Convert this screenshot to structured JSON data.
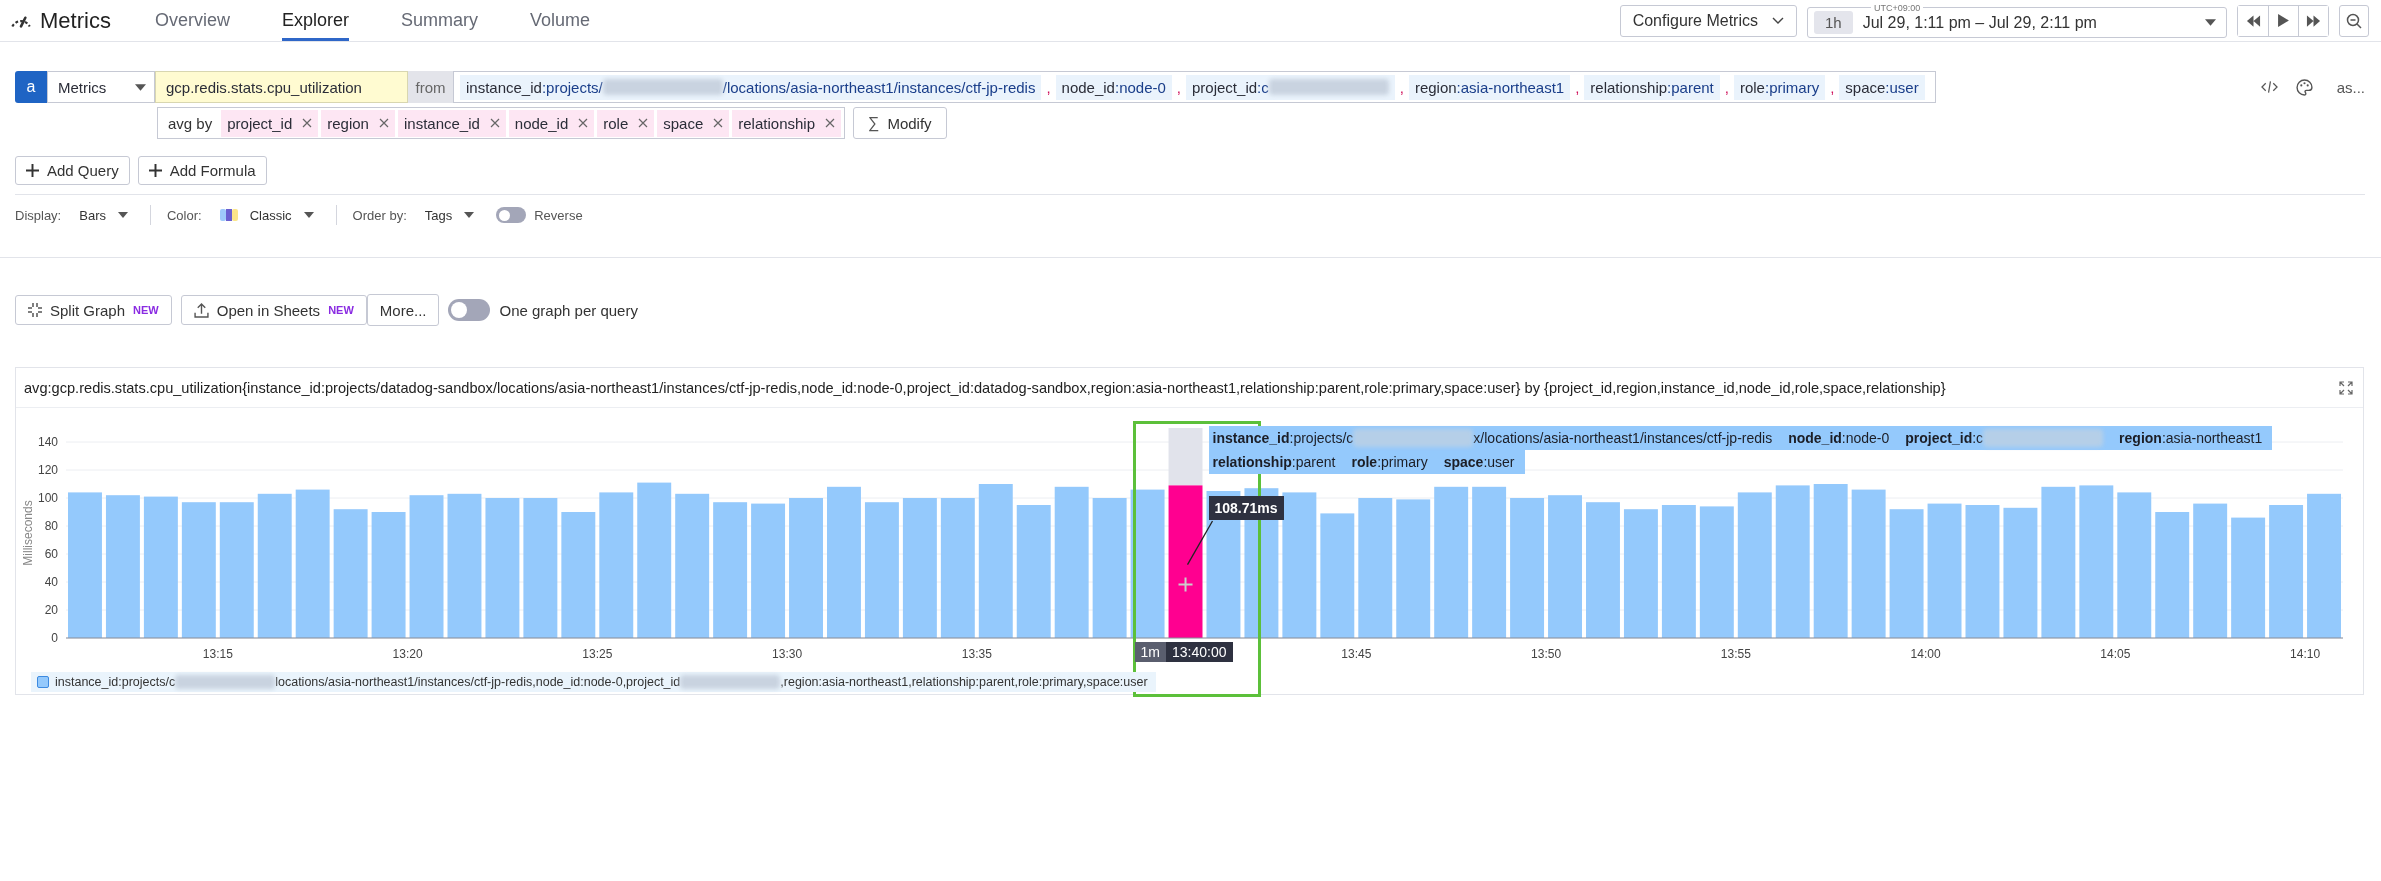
{
  "header": {
    "title": "Metrics",
    "tabs": [
      {
        "label": "Overview",
        "selected": false
      },
      {
        "label": "Explorer",
        "selected": true
      },
      {
        "label": "Summary",
        "selected": false
      },
      {
        "label": "Volume",
        "selected": false
      }
    ],
    "configure_button": "Configure Metrics",
    "time_picker": {
      "timezone": "UTC+09:00",
      "span": "1h",
      "range": "Jul 29, 1:11 pm – Jul 29, 2:11 pm"
    }
  },
  "query": {
    "letter": "a",
    "source": "Metrics",
    "metric": "gcp.redis.stats.cpu_utilization",
    "from_label": "from",
    "separator": ",",
    "from_tags": [
      {
        "key": "instance_id",
        "parts": [
          {
            "text": ":projects/"
          },
          {
            "redacted": true
          },
          {
            "text": "/locations/asia-northeast1/instances/ctf-jp-redis"
          }
        ]
      },
      {
        "key": "node_id",
        "parts": [
          {
            "text": ":node-0"
          }
        ]
      },
      {
        "key": "project_id",
        "parts": [
          {
            "text": ":c"
          },
          {
            "redacted": true
          }
        ]
      },
      {
        "key": "region",
        "parts": [
          {
            "text": ":asia-northeast1"
          }
        ]
      },
      {
        "key": "relationship",
        "parts": [
          {
            "text": ":parent"
          }
        ]
      },
      {
        "key": "role",
        "parts": [
          {
            "text": ":primary"
          }
        ]
      },
      {
        "key": "space",
        "parts": [
          {
            "text": ":user"
          }
        ]
      }
    ],
    "avg_by_label": "avg by",
    "group_by": [
      "project_id",
      "region",
      "instance_id",
      "node_id",
      "role",
      "space",
      "relationship"
    ],
    "modify_button": {
      "icon": "∑",
      "label": "Modify"
    },
    "side_label": "as..."
  },
  "add_buttons": [
    "Add Query",
    "Add Formula"
  ],
  "display_options": [
    {
      "kind": "select",
      "label": "Display:",
      "value": "Bars"
    },
    {
      "kind": "palette",
      "label": "Color:",
      "value": "Classic"
    },
    {
      "kind": "select",
      "label": "Order by:",
      "value": "Tags"
    },
    {
      "kind": "toggle",
      "label": "Reverse",
      "on": false
    }
  ],
  "graph_actions": [
    {
      "kind": "split",
      "label": "Split Graph",
      "badge": "NEW"
    },
    {
      "kind": "export",
      "label": "Open in Sheets",
      "badge": "NEW"
    },
    {
      "kind": "more",
      "label": "More..."
    }
  ],
  "one_graph_toggle": {
    "label": "One graph per query",
    "on": false
  },
  "graph": {
    "title": "avg:gcp.redis.stats.cpu_utilization{instance_id:projects/datadog-sandbox/locations/asia-northeast1/instances/ctf-jp-redis,node_id:node-0,project_id:datadog-sandbox,region:asia-northeast1,relationship:parent,role:primary,space:user} by {project_id,region,instance_id,node_id,role,space,relationship}",
    "chart_data": {
      "type": "bar",
      "ylabel": "Milliseconds",
      "ylim": [
        0,
        150
      ],
      "grid": true,
      "stacked": true,
      "categories": [
        null,
        null,
        null,
        null,
        "13:15",
        null,
        null,
        null,
        null,
        "13:20",
        null,
        null,
        null,
        null,
        "13:25",
        null,
        null,
        null,
        null,
        "13:30",
        null,
        null,
        null,
        null,
        "13:35",
        null,
        null,
        null,
        null,
        null,
        null,
        null,
        null,
        null,
        "13:45",
        null,
        null,
        null,
        null,
        "13:50",
        null,
        null,
        null,
        null,
        "13:55",
        null,
        null,
        null,
        null,
        "14:00",
        null,
        null,
        null,
        null,
        "14:05",
        null,
        null,
        null,
        null,
        "14:10"
      ],
      "yticks": [
        0,
        20,
        40,
        60,
        80,
        100,
        120,
        140
      ],
      "series": [
        {
          "color": "#94c9fc",
          "values": [
            104,
            102,
            101,
            97,
            97,
            103,
            106,
            92,
            90,
            102,
            103,
            100,
            100,
            90,
            104,
            111,
            103,
            97,
            96,
            100,
            108,
            97,
            100,
            100,
            110,
            95,
            108,
            100,
            106,
            null,
            105,
            107,
            104,
            89,
            100,
            99,
            108,
            108,
            100,
            102,
            97,
            92,
            95,
            94,
            104,
            109,
            110,
            106,
            92,
            96,
            95,
            93,
            108,
            109,
            104,
            90,
            96,
            86,
            95,
            103
          ]
        },
        {
          "color": "#ff0090",
          "values": [
            null,
            null,
            null,
            null,
            null,
            null,
            null,
            null,
            null,
            null,
            null,
            null,
            null,
            null,
            null,
            null,
            null,
            null,
            null,
            null,
            null,
            null,
            null,
            null,
            null,
            null,
            null,
            null,
            null,
            109,
            null,
            null,
            null,
            null,
            null,
            null,
            null,
            null,
            null,
            null,
            null,
            null,
            null,
            null,
            null,
            null,
            null,
            null,
            null,
            null,
            null,
            null,
            null,
            null,
            null,
            null,
            null,
            null,
            null,
            null
          ]
        }
      ]
    },
    "tooltip": {
      "first_line": [
        {
          "key": "instance_id",
          "parts": [
            {
              "text": ":projects/c"
            },
            {
              "redacted": true
            },
            {
              "text": "x/locations/asia-northeast1/instances/ctf-jp-redis"
            }
          ]
        },
        {
          "key": "node_id",
          "parts": [
            {
              "text": ":node-0"
            }
          ]
        },
        {
          "key": "project_id",
          "parts": [
            {
              "text": ":c"
            },
            {
              "redacted": true
            }
          ]
        },
        {
          "key": "region",
          "parts": [
            {
              "text": ":asia-northeast1"
            }
          ]
        }
      ],
      "second_line": [
        {
          "key": "relationship",
          "parts": [
            {
              "text": ":parent"
            }
          ]
        },
        {
          "key": "role",
          "parts": [
            {
              "text": ":primary"
            }
          ]
        },
        {
          "key": "space",
          "parts": [
            {
              "text": ":user"
            }
          ]
        }
      ],
      "value_label": "108.71ms",
      "interval": "1m",
      "time": "13:40:00"
    },
    "legend": {
      "color": "#94c9fc",
      "parts": [
        {
          "text": "instance_id:projects/c"
        },
        {
          "redacted": true
        },
        {
          "text": "locations/asia-northeast1/instances/ctf-jp-redis,node_id:node-0,project_id"
        },
        {
          "redacted": true
        },
        {
          "text": ",region:asia-northeast1,relationship:parent,role:primary,space:user"
        }
      ]
    }
  }
}
